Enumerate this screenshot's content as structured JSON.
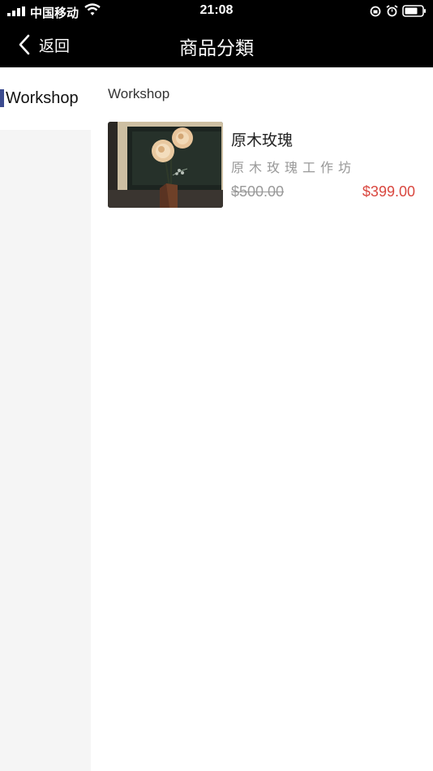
{
  "status_bar": {
    "carrier": "中国移动",
    "time": "21:08"
  },
  "nav": {
    "back_label": "返回",
    "title": "商品分類"
  },
  "sidebar": {
    "items": [
      {
        "label": "Workshop",
        "selected": true
      }
    ],
    "accent_color": "#3b4b8f"
  },
  "main": {
    "section_title": "Workshop",
    "products": [
      {
        "name": "原木玫瑰",
        "subtitle": "原木玫瑰工作坊",
        "original_price": "$500.00",
        "price": "$399.00"
      }
    ]
  },
  "colors": {
    "price": "#d9473f",
    "muted": "#999999"
  }
}
